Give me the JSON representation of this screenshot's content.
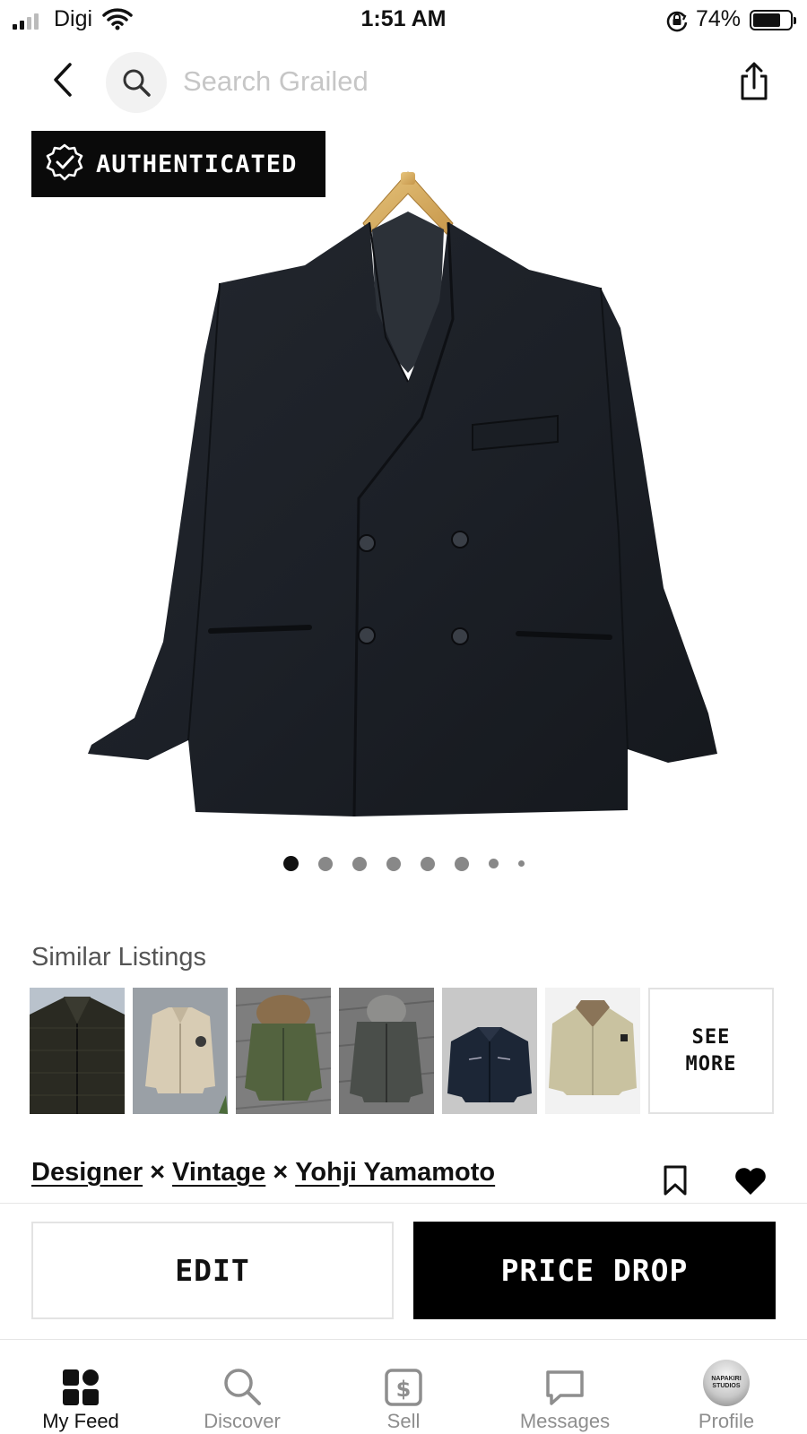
{
  "status_bar": {
    "carrier": "Digi",
    "time": "1:51 AM",
    "battery_percent": "74%",
    "battery_level": 0.74,
    "signal_bars_active": 2,
    "icons": [
      "signal-icon",
      "wifi-icon",
      "orientation-lock-icon",
      "battery-icon"
    ]
  },
  "nav": {
    "search_placeholder": "Search Grailed",
    "icons": [
      "back-chevron-icon",
      "search-icon",
      "share-icon"
    ]
  },
  "hero": {
    "badge_label": "AUTHENTICATED",
    "badge_icon": "verified-seal-icon",
    "image_subject": "black double-breasted collarless jacket on wooden hanger",
    "carousel": {
      "total": 8,
      "active_index": 0
    }
  },
  "similar": {
    "title": "Similar Listings",
    "see_more_label": "SEE\nMORE",
    "thumbnails": [
      "dark plaid zip jacket",
      "beige work jacket",
      "green fur-hood parka",
      "grey hooded jacket",
      "navy zip jacket",
      "khaki shearling-collar jacket"
    ]
  },
  "listing": {
    "designers": [
      "Designer",
      "Vintage",
      "Yohji Yamamoto"
    ],
    "separator": "×",
    "icons": [
      "bookmark-icon",
      "heart-icon"
    ]
  },
  "actions": {
    "edit_label": "EDIT",
    "price_drop_label": "PRICE DROP"
  },
  "tabbar": {
    "tabs": [
      {
        "label": "My Feed",
        "icon": "feed-grid-icon",
        "active": true
      },
      {
        "label": "Discover",
        "icon": "search-icon",
        "active": false
      },
      {
        "label": "Sell",
        "icon": "dollar-tag-icon",
        "active": false
      },
      {
        "label": "Messages",
        "icon": "chat-bubble-icon",
        "active": false
      },
      {
        "label": "Profile",
        "icon": "avatar-icon",
        "active": false
      }
    ],
    "avatar_text": "NAPAKIRI\nSTUDIOS"
  },
  "colors": {
    "black": "#000000",
    "text": "#111111",
    "muted": "#8e8e8e",
    "placeholder": "#c6c6c6",
    "border": "#e3e3e3"
  }
}
